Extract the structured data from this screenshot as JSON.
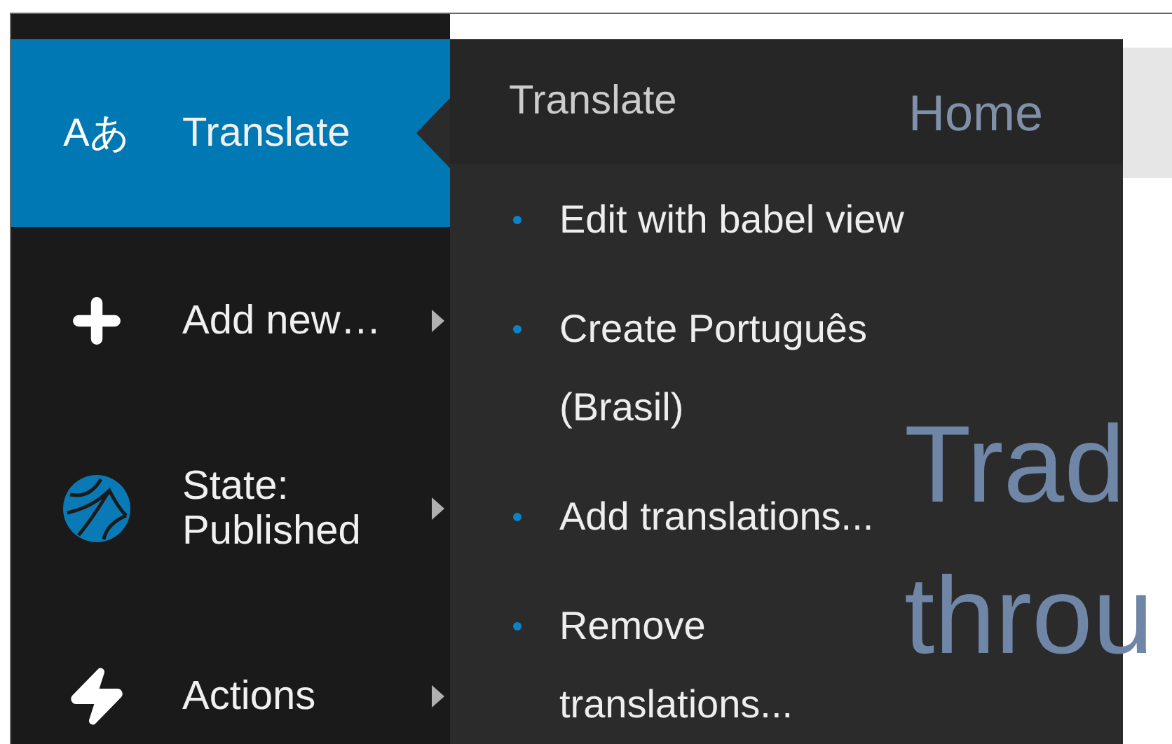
{
  "sidebar": {
    "items": [
      {
        "kind": "translate",
        "icon_text": "Aあ",
        "label": "Translate",
        "selected": true,
        "expanded": true
      },
      {
        "kind": "add",
        "label": "Add new…",
        "selected": false,
        "expanded": false
      },
      {
        "kind": "state",
        "label": "State: Published",
        "selected": false,
        "expanded": false
      },
      {
        "kind": "actions",
        "label": "Actions",
        "selected": false,
        "expanded": false
      }
    ]
  },
  "submenu": {
    "title": "Translate",
    "items": [
      "Edit with babel view",
      "Create Português (Brasil)",
      "Add translations...",
      "Remove translations..."
    ]
  },
  "page": {
    "breadcrumb": "Home",
    "heading": "Trad throu"
  }
}
